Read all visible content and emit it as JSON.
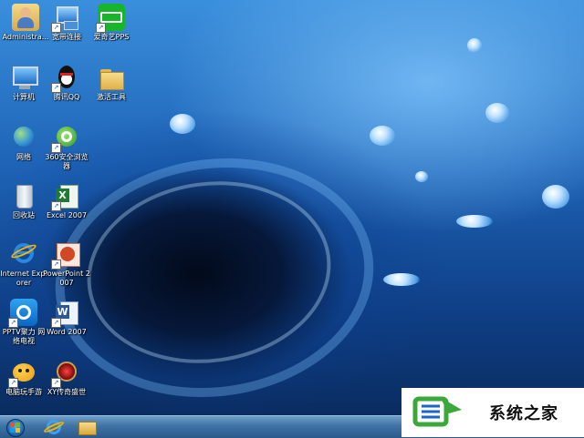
{
  "desktop_icons": [
    {
      "label": "Administra...",
      "icon": "admin-user-folder-icon",
      "shortcut": false
    },
    {
      "label": "宽带连接",
      "icon": "broadband-connection-icon",
      "shortcut": true
    },
    {
      "label": "爱奇艺PPS",
      "icon": "iqiyi-pps-icon",
      "shortcut": true
    },
    {
      "label": "计算机",
      "icon": "computer-icon",
      "shortcut": false
    },
    {
      "label": "腾讯QQ",
      "icon": "qq-penguin-icon",
      "shortcut": true
    },
    {
      "label": "激活工具",
      "icon": "folder-icon",
      "shortcut": false
    },
    {
      "label": "网络",
      "icon": "network-globe-icon",
      "shortcut": false
    },
    {
      "label": "360安全浏览器",
      "icon": "360-browser-icon",
      "shortcut": true
    },
    {
      "label": "回收站",
      "icon": "recycle-bin-icon",
      "shortcut": false
    },
    {
      "label": "Excel 2007",
      "icon": "excel-icon",
      "shortcut": true
    },
    {
      "label": "Internet Explorer",
      "icon": "internet-explorer-icon",
      "shortcut": false
    },
    {
      "label": "PowerPoint 2007",
      "icon": "powerpoint-icon",
      "shortcut": true
    },
    {
      "label": "PPTV聚力 网络电视",
      "icon": "pptv-icon",
      "shortcut": true
    },
    {
      "label": "Word 2007",
      "icon": "word-icon",
      "shortcut": true
    },
    {
      "label": "电脑玩手游",
      "icon": "mobile-game-icon",
      "shortcut": true
    },
    {
      "label": "XY传奇盛世",
      "icon": "xy-legend-game-icon",
      "shortcut": true
    }
  ],
  "taskbar": {
    "start": "start-orb-icon",
    "pinned": [
      "internet-explorer-icon",
      "file-explorer-folder-icon"
    ]
  },
  "watermark": {
    "text": "系统之家",
    "logo": "xitongzhijia-logo"
  },
  "colors": {
    "taskbar": "#3f73a5",
    "wallpaper": "#1e63b6",
    "watermark_green": "#3aa83a"
  }
}
